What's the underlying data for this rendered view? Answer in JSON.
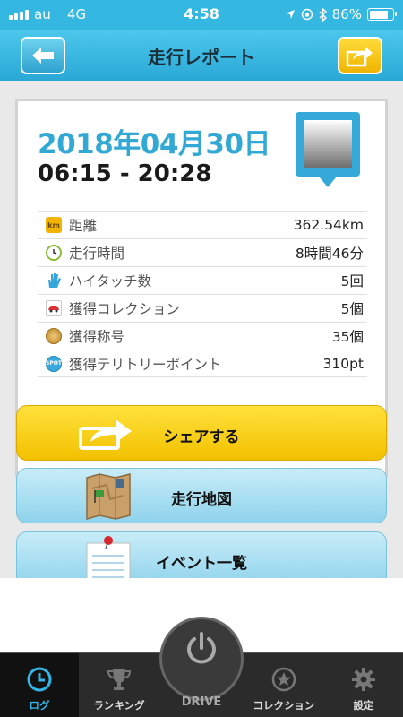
{
  "status_bar": {
    "carrier": "au",
    "network": "4G",
    "time": "4:58",
    "battery": "86%",
    "battery_level": 0.86
  },
  "nav": {
    "title": "走行レポート",
    "back_icon": "back-arrow-icon",
    "share_icon": "share-arrow-icon"
  },
  "report": {
    "date": "2018年04月30日",
    "time_range": "06:15 - 20:28",
    "stats": [
      {
        "icon": "km-icon",
        "label": "距離",
        "value": "362.54km"
      },
      {
        "icon": "clock-icon",
        "label": "走行時間",
        "value": "8時間46分"
      },
      {
        "icon": "high-five-icon",
        "label": "ハイタッチ数",
        "value": "5回"
      },
      {
        "icon": "car-icon",
        "label": "獲得コレクション",
        "value": "5個"
      },
      {
        "icon": "medal-icon",
        "label": "獲得称号",
        "value": "35個"
      },
      {
        "icon": "spot-icon",
        "label": "獲得テリトリーポイント",
        "value": "310pt"
      }
    ]
  },
  "actions": {
    "share_label": "シェアする",
    "map_label": "走行地図",
    "events_label": "イベント一覧"
  },
  "tabs": {
    "log": "ログ",
    "ranking": "ランキング",
    "drive": "DRIVE",
    "collection": "コレクション",
    "settings": "設定"
  },
  "colors": {
    "accent_blue": "#34b7e0",
    "share_yellow": "#f6c800",
    "light_blue_button": "#a8def2",
    "tab_bar": "#2b2b2b",
    "date_blue": "#32a8d4"
  }
}
